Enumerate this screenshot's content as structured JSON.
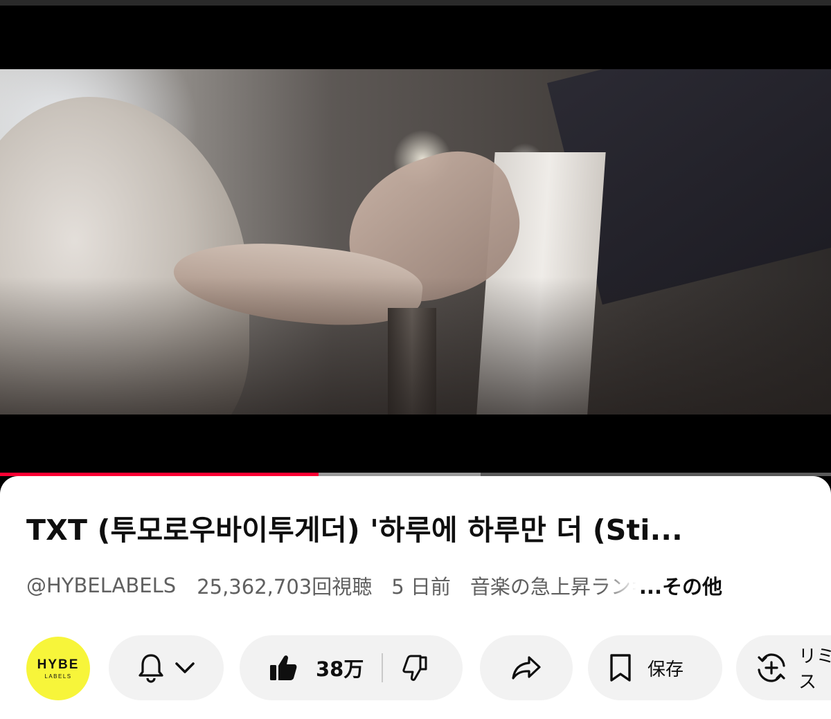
{
  "video": {
    "progress_played_fraction": 0.383,
    "progress_buffered_fraction": 0.578,
    "accent_color": "#ff0033"
  },
  "info": {
    "title": "TXT (투모로우바이투게더) '하루에 하루만 더 (Sti...",
    "channel_handle": "@HYBELABELS",
    "views": "25,362,703回視聴",
    "published": "5 日前",
    "ranking": "音楽の急上昇ランキング",
    "more_label": "...その他"
  },
  "channel": {
    "logo_main": "HYBE",
    "logo_sub": "LABELS",
    "logo_color": "#f7f53a"
  },
  "actions": {
    "bell_icon": "bell-icon",
    "like_count": "38万",
    "save_label": "保存",
    "remix_label": "リミックス"
  }
}
